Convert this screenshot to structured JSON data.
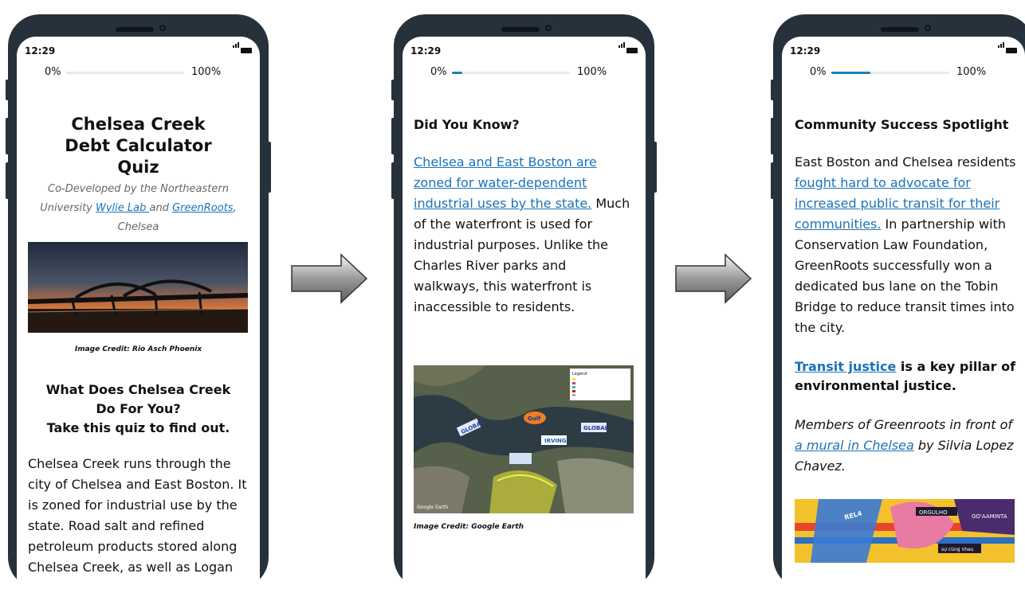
{
  "status_time": "12:29",
  "progress": {
    "start_label": "0%",
    "end_label": "100%"
  },
  "screen1": {
    "progress_value": 0,
    "title": "Chelsea Creek Debt Calculator Quiz",
    "subtitle_prefix": "Co-Developed by the Northeastern University ",
    "subtitle_link1": "Wylie Lab ",
    "subtitle_mid": "and ",
    "subtitle_link2": "GreenRoots",
    "subtitle_suffix": ", Chelsea",
    "image_credit": "Image Credit: Rio Asch Phoenix",
    "heading_line1": "What Does Chelsea Creek Do For You?",
    "heading_line2": "Take this quiz to find out.",
    "body": "Chelsea Creek runs through the city of Chelsea and East Boston. It is zoned for industrial use by the state. Road salt and refined petroleum products stored along Chelsea Creek, as well as Logan"
  },
  "screen2": {
    "progress_value": 0.09,
    "heading": "Did You Know?",
    "link_text": "Chelsea and East Boston are zoned for water-dependent industrial uses by the state.",
    "body": " Much of the waterfront is used for industrial purposes. Unlike the Charles River parks and walkways, this waterfront is inaccessible to residents.",
    "map_labels": [
      "GLOBAL",
      "Gulf",
      "IRVING",
      "GLOBAL",
      "Google Earth",
      "Legend"
    ],
    "image_credit": "Image Credit: Google Earth"
  },
  "screen3": {
    "progress_value": 0.33,
    "heading": "Community Success Spotlight",
    "para_prefix": "East Boston and Chelsea residents ",
    "para_link": "fought hard to advocate for increased public transit for their communities.",
    "para_suffix": " In partnership with Conservation Law Foundation, GreenRoots successfully won a dedicated bus lane on the Tobin Bridge to reduce transit times into the city.",
    "bold_link": "Transit justice",
    "bold_suffix": " is a key pillar of environmental justice.",
    "caption_prefix": "Members of Greenroots in front of ",
    "caption_link": "a mural in Chelsea",
    "caption_suffix": " by Silvia Lopez Chavez.",
    "mural_words": [
      "ORGULHO",
      "GO'AAMINTA",
      "REL4",
      "sự cùng nhau"
    ]
  },
  "colors": {
    "phone": "#27313b",
    "link": "#1a73b8",
    "progress": "#1c7fb8"
  }
}
